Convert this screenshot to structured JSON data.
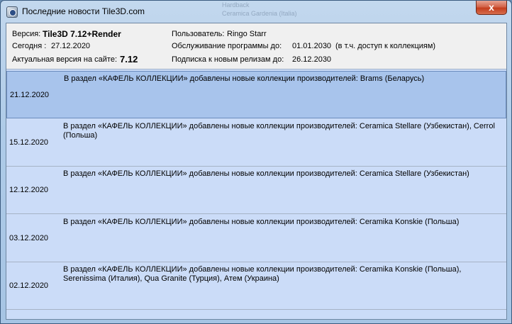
{
  "window": {
    "title": "Последние новости Tile3D.com",
    "close_label": "x",
    "background_labels": [
      "Hardback",
      "Ceramica Gardenia (Italia)"
    ]
  },
  "info": {
    "version_label": "Версия:",
    "version_value": "Tile3D 7.12+Render",
    "today_label": "Сегодня :",
    "today_value": "27.12.2020",
    "actual_label": "Актуальная версия на сайте:",
    "actual_value": "7.12",
    "user_label": "Пользователь:",
    "user_value": "Ringo Starr",
    "service_label": "Обслуживание программы до:",
    "service_value": "01.01.2030",
    "service_note": "(в т.ч. доступ к коллекциям)",
    "subscription_label": "Подписка к новым релизам до:",
    "subscription_value": "26.12.2030"
  },
  "news": [
    {
      "date": "21.12.2020",
      "text": "В раздел «КАФЕЛЬ КОЛЛЕКЦИИ» добавлены новые коллекции производителей: Brams (Беларусь)",
      "selected": true
    },
    {
      "date": "15.12.2020",
      "text": "В раздел «КАФЕЛЬ КОЛЛЕКЦИИ» добавлены новые коллекции производителей: Ceramica Stellare (Узбекистан), Cerrol (Польша)",
      "selected": false
    },
    {
      "date": "12.12.2020",
      "text": "В раздел «КАФЕЛЬ КОЛЛЕКЦИИ» добавлены новые коллекции производителей: Ceramica Stellare (Узбекистан)",
      "selected": false
    },
    {
      "date": "03.12.2020",
      "text": "В раздел «КАФЕЛЬ КОЛЛЕКЦИИ» добавлены новые коллекции производителей: Ceramika Konskie (Польша)",
      "selected": false
    },
    {
      "date": "02.12.2020",
      "text": "В раздел «КАФЕЛЬ КОЛЛЕКЦИИ» добавлены новые коллекции производителей: Ceramika Konskie (Польша), Serenissima (Италия), Qua Granite (Турция), Атем (Украина)",
      "selected": false
    }
  ]
}
